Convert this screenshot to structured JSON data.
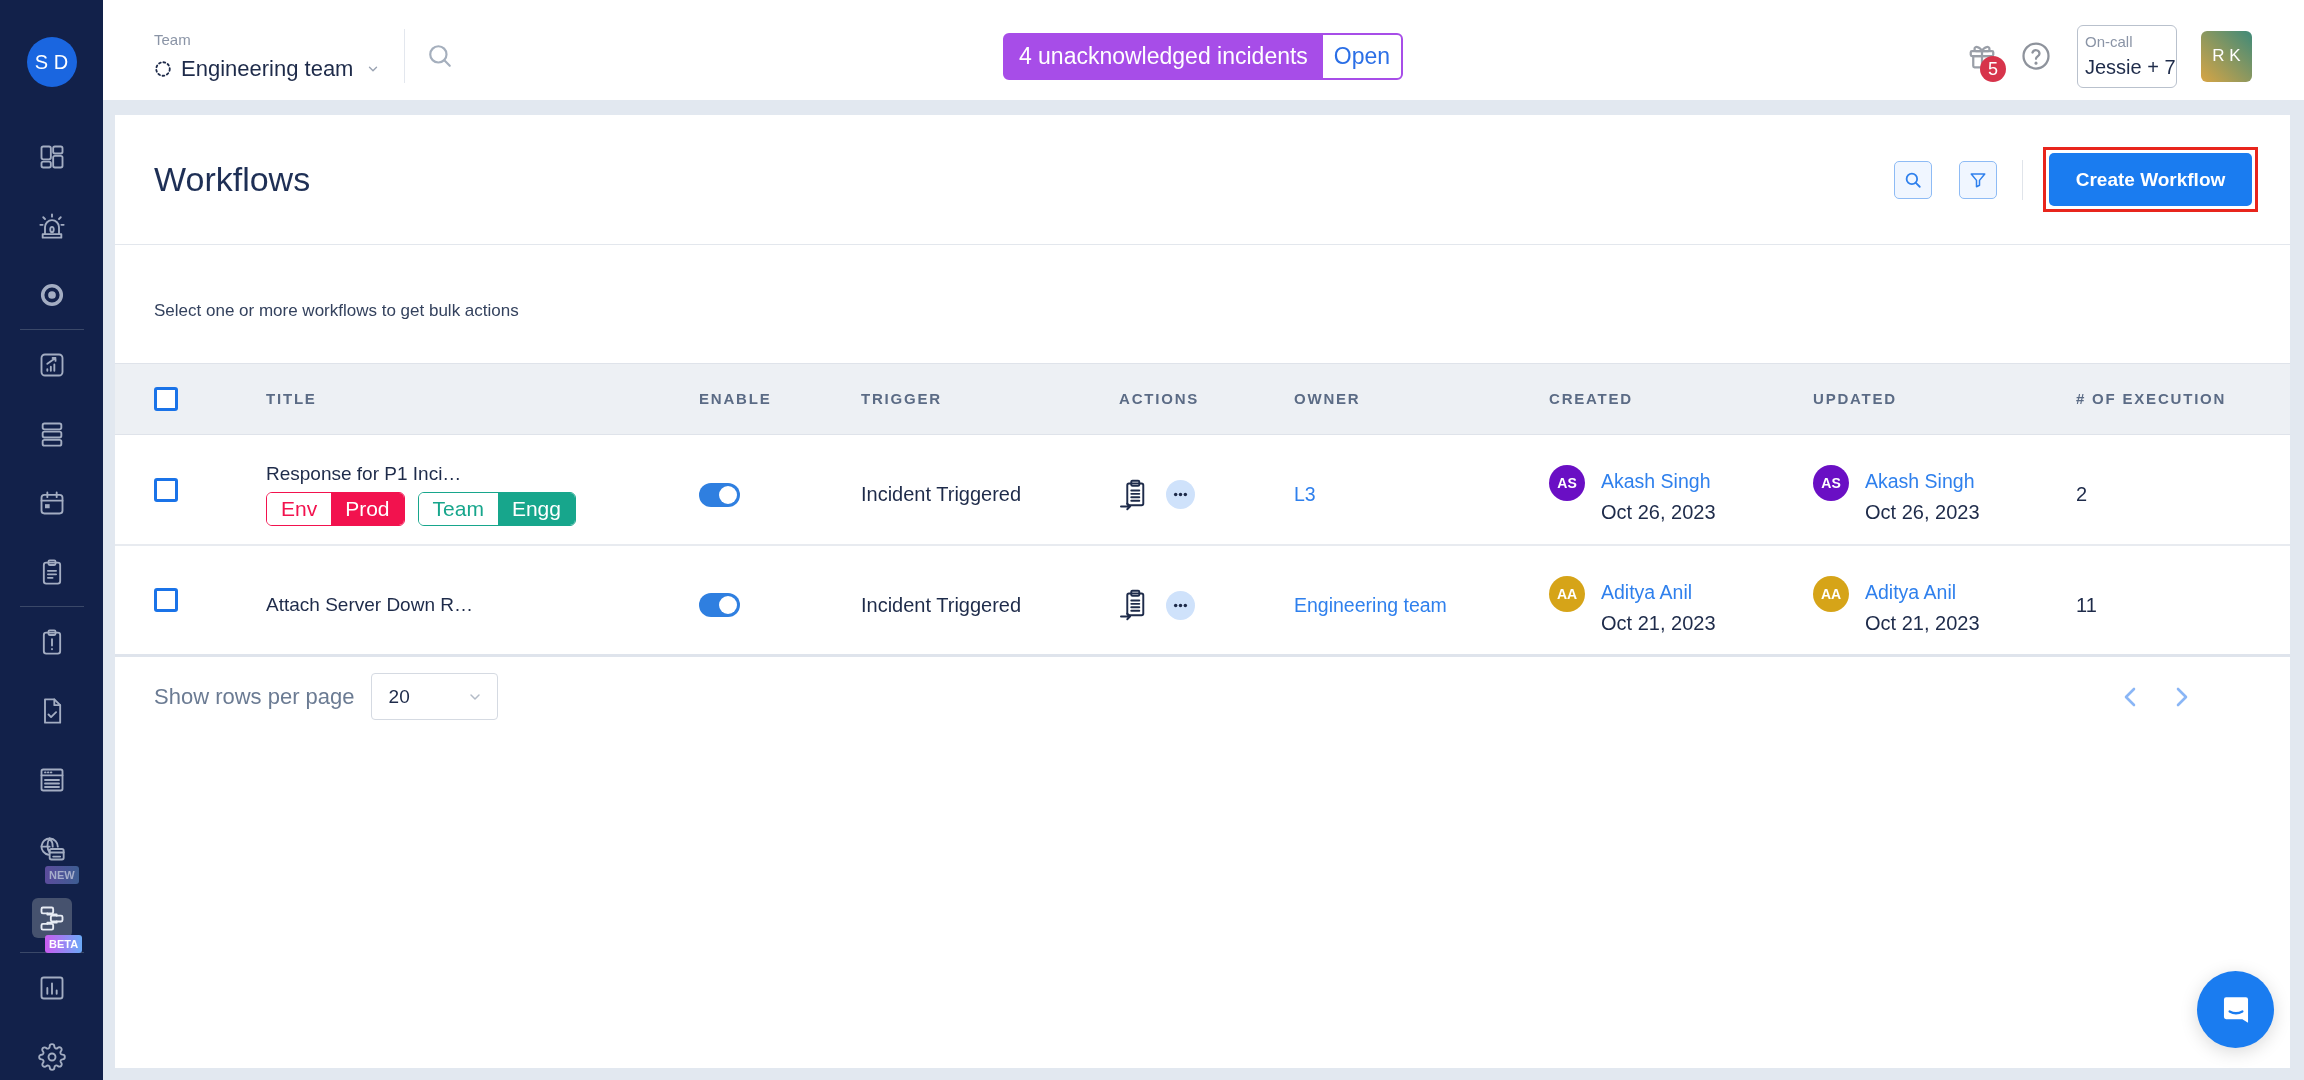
{
  "sidebar": {
    "avatar": "S D",
    "sections": [
      [
        {
          "selected": false
        },
        {
          "selected": false
        },
        {
          "selected": false
        }
      ],
      [
        {
          "selected": false
        },
        {
          "selected": false
        },
        {
          "selected": false
        },
        {
          "selected": false
        }
      ],
      [
        {
          "selected": false
        },
        {
          "selected": false
        },
        {
          "selected": false
        },
        {
          "selected": false,
          "badge": {
            "text": "NEW",
            "kind": "new"
          }
        },
        {
          "selected": true,
          "badge": {
            "text": "BETA",
            "kind": "beta"
          }
        }
      ],
      [
        {
          "selected": false
        },
        {
          "selected": false
        }
      ]
    ]
  },
  "topbar": {
    "team_label": "Team",
    "team_name": "Engineering team",
    "incident_banner": {
      "message": "4 unacknowledged incidents",
      "action": "Open"
    },
    "notification_count": "5",
    "on_call": {
      "label": "On-call",
      "value": "Jessie + 7"
    },
    "user_avatar": "R K"
  },
  "page_header": {
    "title": "Workflows",
    "create_button": {
      "label": "Create Workflow",
      "highlighted": true
    }
  },
  "bulk_hint": "Select one or more workflows to get bulk actions",
  "table": {
    "select_all_checked": false,
    "columns": [
      "TITLE",
      "ENABLE",
      "TRIGGER",
      "ACTIONS",
      "OWNER",
      "CREATED",
      "UPDATED",
      "# OF EXECUTION"
    ],
    "rows": [
      {
        "checked": false,
        "title": "Response for P1 Inci…",
        "tags": [
          {
            "key": "Env",
            "value": "Prod",
            "color": "#f2124e"
          },
          {
            "key": "Team",
            "value": "Engg",
            "color": "#17a68c"
          }
        ],
        "enabled": true,
        "trigger": "Incident Triggered",
        "owner": "L3",
        "created": {
          "initials": "AS",
          "name": "Akash Singh",
          "date": "Oct 26, 2023",
          "color": "#6a0fc4"
        },
        "updated": {
          "initials": "AS",
          "name": "Akash Singh",
          "date": "Oct 26, 2023",
          "color": "#6a0fc4"
        },
        "executions": "2"
      },
      {
        "checked": false,
        "title": "Attach Server Down R…",
        "enabled": true,
        "trigger": "Incident Triggered",
        "owner": "Engineering team",
        "created": {
          "initials": "AA",
          "name": "Aditya Anil",
          "date": "Oct 21, 2023",
          "color": "#d6a418"
        },
        "updated": {
          "initials": "AA",
          "name": "Aditya Anil",
          "date": "Oct 21, 2023",
          "color": "#d6a418"
        },
        "executions": "11"
      }
    ]
  },
  "pagination": {
    "label": "Show rows per page",
    "rows_per_page": "20"
  }
}
